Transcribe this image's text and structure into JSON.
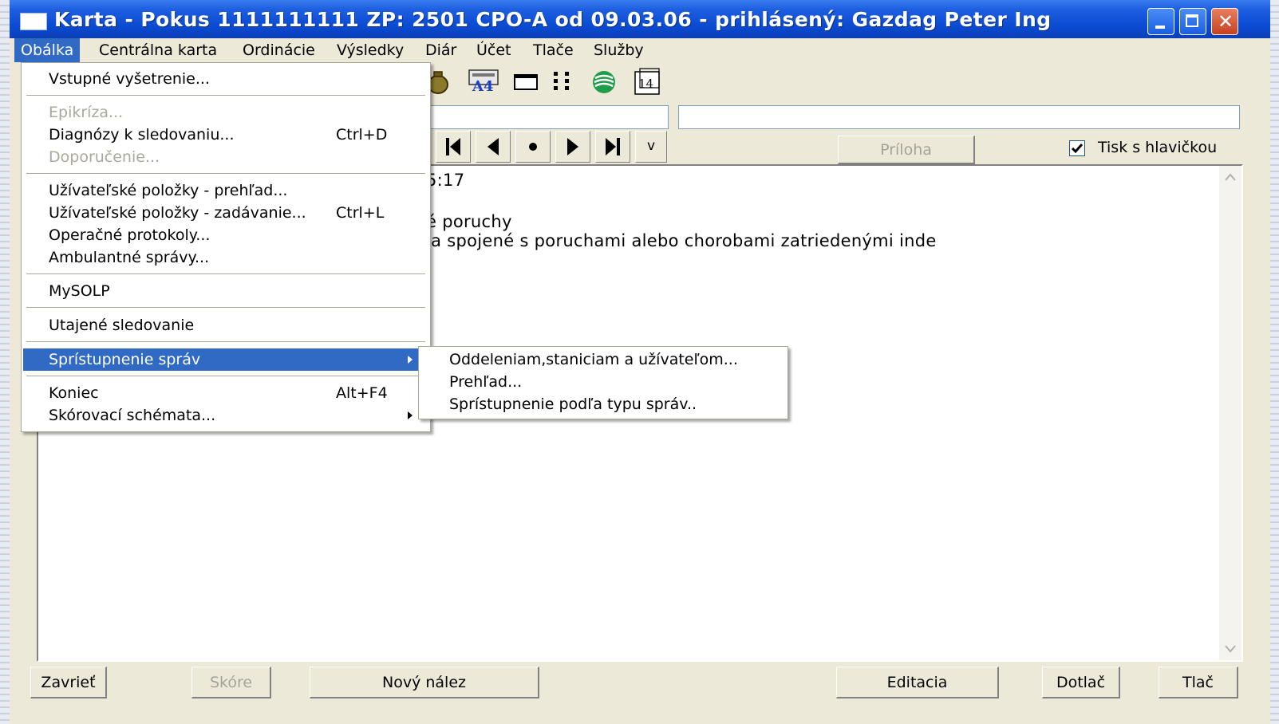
{
  "window": {
    "title": "Karta - Pokus  1111111111   ZP: 2501 CPO-A od 09.03.06 - prihlásený: Gazdag Peter Ing",
    "close_glyph": "✕"
  },
  "menubar": {
    "items": [
      "Obálka",
      "Centrálna karta",
      "Ordinácie",
      "Výsledky",
      "Diár",
      "Účet",
      "Tlače",
      "Služby"
    ]
  },
  "dropdown": {
    "items": [
      {
        "label": "Vstupné vyšetrenie...",
        "shortcut": ""
      },
      {
        "label": "Epikríza...",
        "shortcut": ""
      },
      {
        "label": "Diagnózy k sledovaniu...",
        "shortcut": "Ctrl+D"
      },
      {
        "label": "Doporučenie...",
        "shortcut": ""
      },
      {
        "label": "Užívateľské položky - prehľad...",
        "shortcut": ""
      },
      {
        "label": "Užívateľské položky - zadávanie...",
        "shortcut": "Ctrl+L"
      },
      {
        "label": "Operačné protokoly...",
        "shortcut": ""
      },
      {
        "label": "Ambulantné správy...",
        "shortcut": ""
      },
      {
        "label": "MySOLP",
        "shortcut": ""
      },
      {
        "label": "Utajené sledovanie",
        "shortcut": ""
      },
      {
        "label": "Sprístupnenie správ",
        "shortcut": ""
      },
      {
        "label": "Koniec",
        "shortcut": "Alt+F4"
      },
      {
        "label": "Skórovací schémata...",
        "shortcut": ""
      }
    ]
  },
  "submenu": {
    "items": [
      "Oddeleniam,staniciam a užívateľom...",
      "Prehľad...",
      "Sprístupnenie podľa typu správ.."
    ]
  },
  "toolbar": {
    "nav_more_label": "v",
    "attachment_label": "Príloha",
    "print_header_label": "Tisk s hlavičkou",
    "print_header_checked": true,
    "a4_label": "A4",
    "calendar_label": "14"
  },
  "content": {
    "lines": [
      "5:17",
      "é poruchy",
      "ia spojené s poruchami alebo chorobami zatriedenými inde"
    ]
  },
  "buttons": {
    "close": "Zavrieť",
    "score": "Skóre",
    "new_finding": "Nový nález",
    "edit": "Editacia",
    "reprint": "Dotlač",
    "print": "Tlač"
  },
  "colors": {
    "titlebar": "#0a4ad2",
    "highlight": "#316ac5",
    "window_bg": "#ece9d8"
  }
}
